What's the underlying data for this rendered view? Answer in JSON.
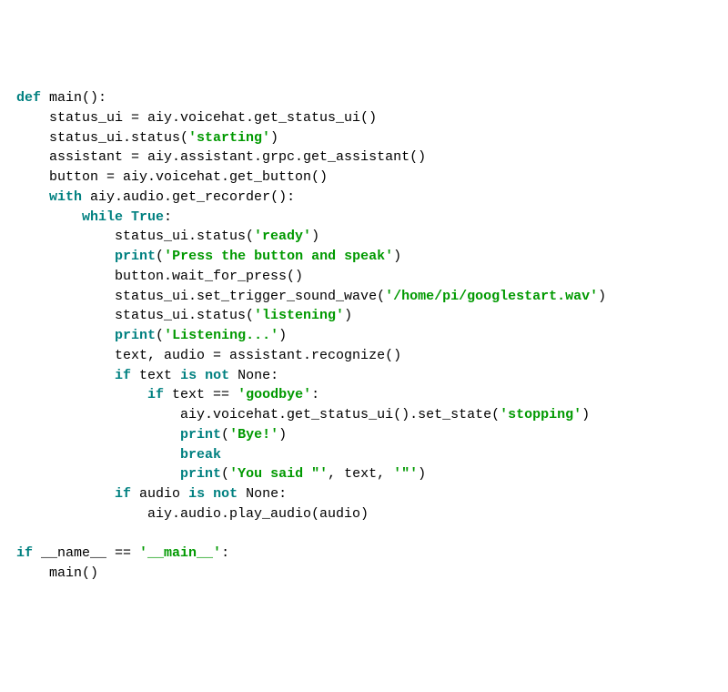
{
  "code": {
    "l01": {
      "def": "def",
      "main": "main",
      "rest": "():"
    },
    "l02": "    status_ui = aiy.voicehat.get_status_ui()",
    "l03": {
      "pre": "    status_ui.status(",
      "s": "'starting'",
      "post": ")"
    },
    "l04": "    assistant = aiy.assistant.grpc.get_assistant()",
    "l05": "    button = aiy.voicehat.get_button()",
    "l06": {
      "with": "with",
      "rest": " aiy.audio.get_recorder():"
    },
    "l07": {
      "while": "while",
      "true": " True",
      "rest": ":"
    },
    "l08": {
      "pre": "            status_ui.status(",
      "s": "'ready'",
      "post": ")"
    },
    "l09": {
      "pre": "            ",
      "print": "print",
      "open": "(",
      "s": "'Press the button and speak'",
      "post": ")"
    },
    "l10": "            button.wait_for_press()",
    "l11": {
      "pre": "            status_ui.set_trigger_sound_wave(",
      "s": "'/home/pi/googlestart.wav'",
      "post": ")"
    },
    "l12": {
      "pre": "            status_ui.status(",
      "s": "'listening'",
      "post": ")"
    },
    "l13": {
      "pre": "            ",
      "print": "print",
      "open": "(",
      "s": "'Listening...'",
      "post": ")"
    },
    "l14": "            text, audio = assistant.recognize()",
    "l15": {
      "pre": "            ",
      "if": "if",
      "mid": " text ",
      "is": "is",
      "sp": " ",
      "not": "not",
      "rest": " None:"
    },
    "l16": {
      "pre": "                ",
      "if": "if",
      "mid": " text == ",
      "s": "'goodbye'",
      "post": ":"
    },
    "l17": {
      "pre": "                    aiy.voicehat.get_status_ui().set_state(",
      "s": "'stopping'",
      "post": ")"
    },
    "l18": {
      "pre": "                    ",
      "print": "print",
      "open": "(",
      "s": "'Bye!'",
      "post": ")"
    },
    "l19": {
      "pre": "                    ",
      "break": "break"
    },
    "l20": {
      "pre": "                    ",
      "print": "print",
      "open": "(",
      "s1": "'You said \"'",
      "mid": ", text, ",
      "s2": "'\"'",
      "post": ")"
    },
    "l21": {
      "pre": "            ",
      "if": "if",
      "mid": " audio ",
      "is": "is",
      "sp": " ",
      "not": "not",
      "rest": " None:"
    },
    "l22": "                aiy.audio.play_audio(audio)",
    "l23": "",
    "l24": {
      "if": "if",
      "pre": " __name__ == ",
      "s": "'__main__'",
      "post": ":"
    },
    "l25": "    main()"
  }
}
